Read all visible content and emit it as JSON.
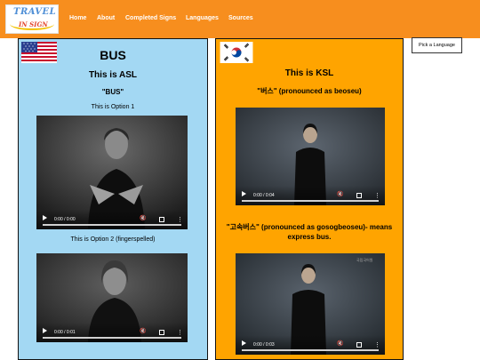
{
  "brand": {
    "logo_line1": "TRAVEL",
    "logo_line2": "IN SIGN"
  },
  "nav": {
    "home": "Home",
    "about": "About",
    "completed_signs": "Completed Signs",
    "languages": "Languages",
    "sources": "Sources"
  },
  "pick_language": "Pick a Language",
  "asl": {
    "word": "BUS",
    "heading": "This is ASL",
    "sign_word": "\"BUS\"",
    "option1": "This is Option 1",
    "video1_time": "0:00 / 0:00",
    "option2": "This is Option 2 (fingerspelled)",
    "video2_time": "0:00 / 0:01"
  },
  "ksl": {
    "heading": "This is KSL",
    "word1": "\"버스\" (pronounced as beoseu)",
    "video1_time": "0:00 / 0:04",
    "word2": "\"고속버스\" (pronounced as gosogbeoseu)- means express bus.",
    "video2_time": "0:00 / 0:03",
    "watermark": "국립국어원"
  },
  "colors": {
    "navbar": "#f78e1e",
    "asl_panel": "#a3d8f3",
    "ksl_panel": "#ffa400"
  }
}
